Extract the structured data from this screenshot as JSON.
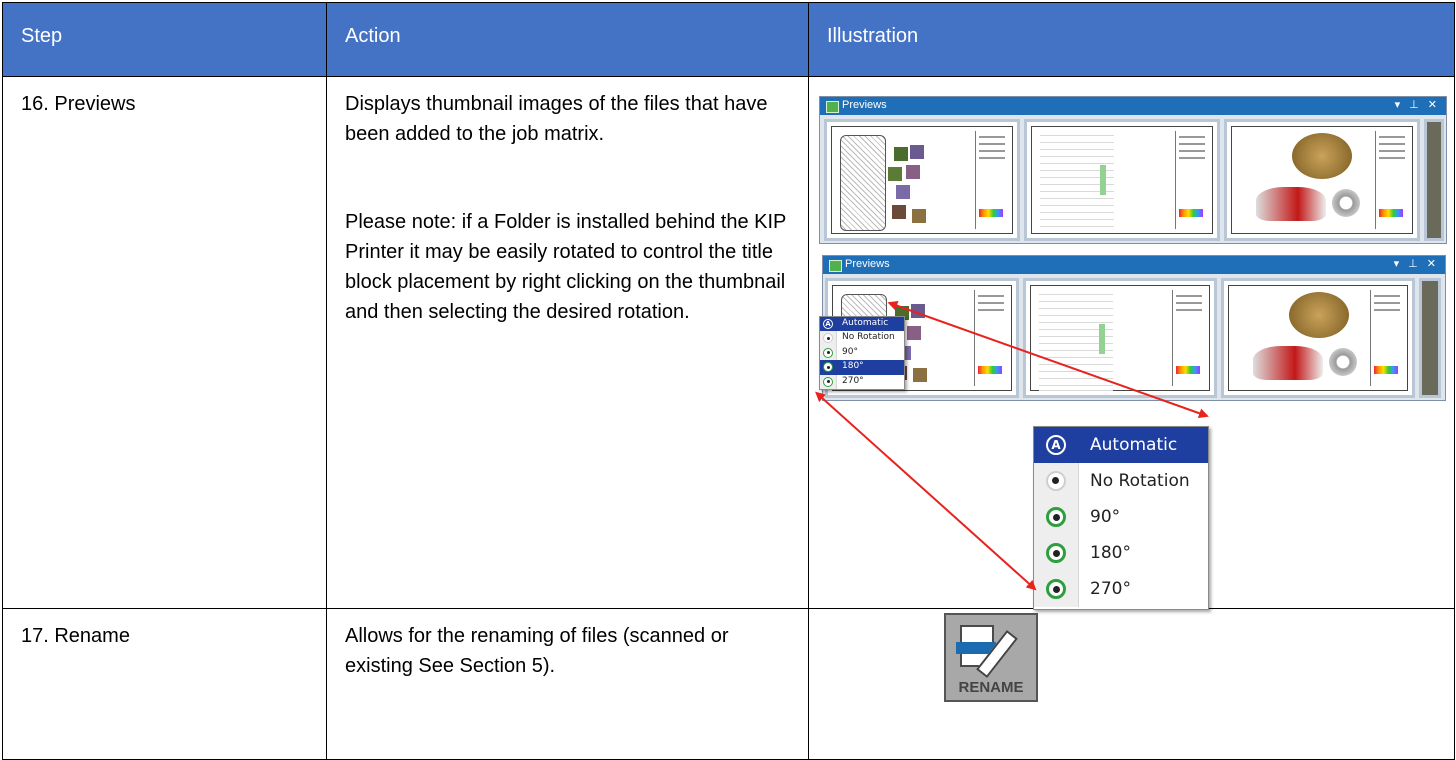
{
  "table": {
    "headers": {
      "step": "Step",
      "action": "Action",
      "illustration": "Illustration"
    },
    "rows": [
      {
        "step": "16.  Previews",
        "action": "Displays thumbnail images of the files that have been added to the job matrix.",
        "note": "Please note: if a Folder is installed behind the KIP Printer it may be easily rotated to control the title block placement by right clicking on the thumbnail and then selecting the desired rotation."
      },
      {
        "step": "17.  Rename",
        "action": "Allows for the renaming of files (scanned or existing See Section 5)."
      }
    ]
  },
  "previews_window": {
    "title": "Previews",
    "controls": "▾ ⊥ ✕"
  },
  "context_menu": {
    "items": [
      {
        "label": "Automatic",
        "icon": "automatic-icon",
        "selected": true
      },
      {
        "label": "No Rotation",
        "icon": "no-rotation-icon"
      },
      {
        "label": "90°",
        "icon": "rotate-90-icon"
      },
      {
        "label": "180°",
        "icon": "rotate-180-icon"
      },
      {
        "label": "270°",
        "icon": "rotate-270-icon"
      }
    ],
    "small_selected": "180°"
  },
  "rename_icon": {
    "label": "RENAME"
  },
  "colors": {
    "header_bg": "#4472c4",
    "titlebar": "#1f6fb8",
    "menu_selected": "#1f3fa0",
    "arrow": "#e8231e"
  }
}
